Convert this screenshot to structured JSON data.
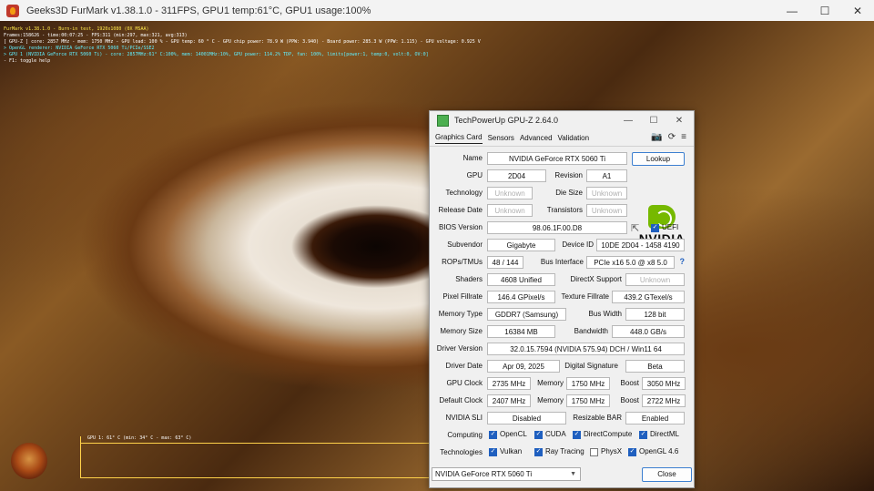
{
  "furmark": {
    "title": "Geeks3D FurMark v1.38.1.0 - 311FPS, GPU1 temp:61°C, GPU1 usage:100%",
    "overlay": [
      {
        "text": "FurMark v1.38.1.0 - Burn-in test, 1920x1080 (0X MSAA)",
        "color": "yellow"
      },
      {
        "text": "Frames:158626 - time:00:07:25 - FPS:311 (min:297, max:321, avg:313)",
        "color": "white"
      },
      {
        "text": "[ GPU-Z ] core: 2857 MHz - mem: 1750 MHz - GPU load: 100 % - GPU temp: 60 ° C - GPU chip power: 78.9 W (PPW: 3.940) - Board power: 285.3 W (PPW: 1.115) - GPU voltage: 0.925 V",
        "color": "white"
      },
      {
        "text": "> OpenGL renderer: NVIDIA GeForce RTX 5060 Ti/PCIe/SSE2",
        "color": "cyan"
      },
      {
        "text": "> GPU 1 (NVIDIA GeForce RTX 5060 Ti) - core: 2857MHz:61° C:100%, mem: 14001MHz:10%, GPU power: 114.2% TDP, fan: 100%, limits[power:1, temp:0, volt:0, OV:0]",
        "color": "cyan"
      },
      {
        "text": "- F1: toggle help",
        "color": "white"
      }
    ],
    "graph_label": "GPU 1: 61° C (min: 34° C - max: 63° C)",
    "window_controls": {
      "minimize": "—",
      "maximize": "☐",
      "close": "✕"
    }
  },
  "gpuz": {
    "title": "TechPowerUp GPU-Z 2.64.0",
    "window_controls": {
      "minimize": "—",
      "maximize": "☐",
      "close": "✕"
    },
    "tabs": [
      "Graphics Card",
      "Sensors",
      "Advanced",
      "Validation"
    ],
    "tools": {
      "camera": "📷",
      "refresh": "⟳",
      "menu": "≡"
    },
    "labels": {
      "name": "Name",
      "gpu": "GPU",
      "revision": "Revision",
      "technology": "Technology",
      "die_size": "Die Size",
      "release_date": "Release Date",
      "transistors": "Transistors",
      "bios_version": "BIOS Version",
      "uefi": "UEFI",
      "subvendor": "Subvendor",
      "device_id": "Device ID",
      "rops_tmus": "ROPs/TMUs",
      "bus_interface": "Bus Interface",
      "shaders": "Shaders",
      "directx_support": "DirectX Support",
      "pixel_fillrate": "Pixel Fillrate",
      "texture_fillrate": "Texture Fillrate",
      "memory_type": "Memory Type",
      "bus_width": "Bus Width",
      "memory_size": "Memory Size",
      "bandwidth": "Bandwidth",
      "driver_version": "Driver Version",
      "driver_date": "Driver Date",
      "digital_signature": "Digital Signature",
      "gpu_clock": "GPU Clock",
      "memory": "Memory",
      "boost": "Boost",
      "default_clock": "Default Clock",
      "nvidia_sli": "NVIDIA SLI",
      "resizable_bar": "Resizable BAR",
      "computing": "Computing",
      "technologies": "Technologies"
    },
    "values": {
      "name": "NVIDIA GeForce RTX 5060 Ti",
      "gpu": "2D04",
      "revision": "A1",
      "technology": "Unknown",
      "die_size": "Unknown",
      "release_date": "Unknown",
      "transistors": "Unknown",
      "bios_version": "98.06.1F.00.D8",
      "subvendor": "Gigabyte",
      "device_id": "10DE 2D04 - 1458 4190",
      "rops_tmus": "48 / 144",
      "bus_interface": "PCIe x16 5.0 @ x8 5.0",
      "shaders": "4608 Unified",
      "directx_support": "Unknown",
      "pixel_fillrate": "146.4 GPixel/s",
      "texture_fillrate": "439.2 GTexel/s",
      "memory_type": "GDDR7 (Samsung)",
      "bus_width": "128 bit",
      "memory_size": "16384 MB",
      "bandwidth": "448.0 GB/s",
      "driver_version": "32.0.15.7594 (NVIDIA 575.94) DCH / Win11 64",
      "driver_date": "Apr 09, 2025",
      "digital_signature": "Beta",
      "gpu_clock": "2735 MHz",
      "gpu_memory": "1750 MHz",
      "gpu_boost": "3050 MHz",
      "default_clock": "2407 MHz",
      "default_memory": "1750 MHz",
      "default_boost": "2722 MHz",
      "nvidia_sli": "Disabled",
      "resizable_bar": "Enabled"
    },
    "lookup_button": "Lookup",
    "help_icon": "?",
    "share_icon": "share-icon",
    "nvidia_logo_text": "NVIDIA",
    "computing": [
      {
        "label": "OpenCL",
        "checked": true
      },
      {
        "label": "CUDA",
        "checked": true
      },
      {
        "label": "DirectCompute",
        "checked": true
      },
      {
        "label": "DirectML",
        "checked": true
      }
    ],
    "technologies": [
      {
        "label": "Vulkan",
        "checked": true
      },
      {
        "label": "Ray Tracing",
        "checked": true
      },
      {
        "label": "PhysX",
        "checked": false
      },
      {
        "label": "OpenGL 4.6",
        "checked": true
      }
    ],
    "gpu_select": "NVIDIA GeForce RTX 5060 Ti",
    "close_button": "Close",
    "uefi_checked": true
  }
}
